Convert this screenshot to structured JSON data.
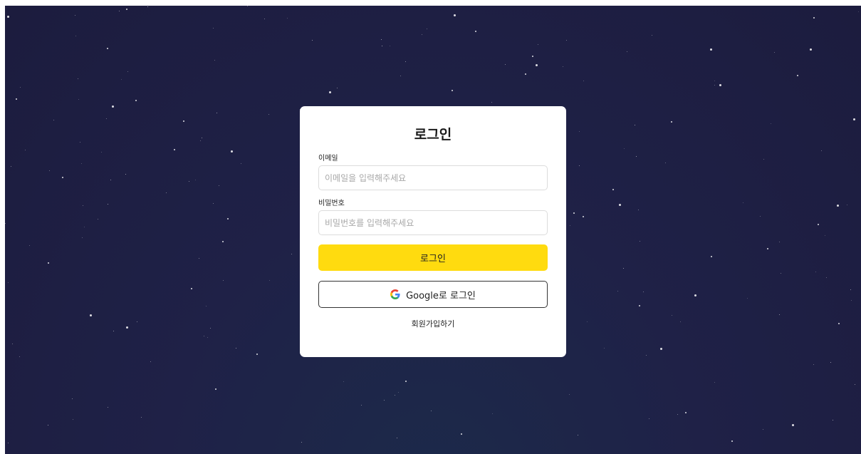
{
  "login": {
    "title": "로그인",
    "email_label": "이메일",
    "email_placeholder": "이메일을 입력해주세요",
    "email_value": "",
    "password_label": "비밀번호",
    "password_placeholder": "비밀번호를 입력해주세요",
    "password_value": "",
    "submit_label": "로그인",
    "google_label": "Google로 로그인",
    "google_icon": "google-g-icon",
    "signup_label": "회원가입하기"
  },
  "theme": {
    "background": "#1f2147",
    "card": "#ffffff",
    "accent": "#ffdb0f",
    "text": "#222222"
  }
}
